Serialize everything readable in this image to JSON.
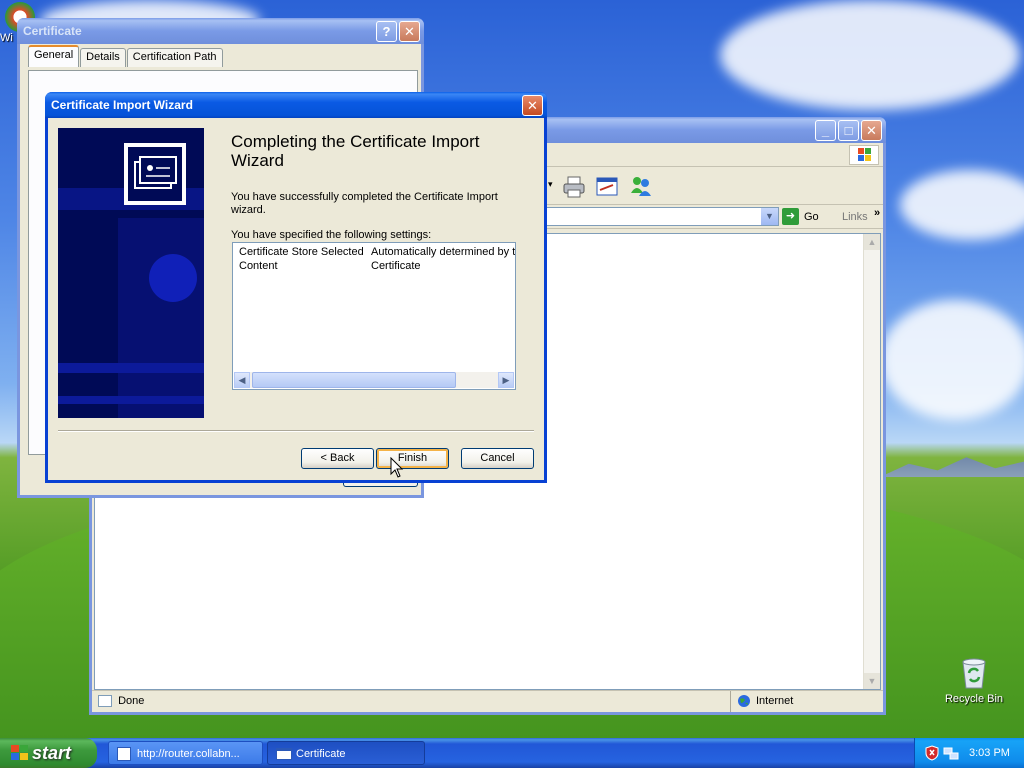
{
  "desktop": {
    "recycle_bin_label": "Recycle Bin",
    "partial_icon_label": "Wi"
  },
  "certificate_window": {
    "title": "Certificate",
    "help_glyph": "?",
    "close_glyph": "✕",
    "tabs": [
      {
        "label": "General"
      },
      {
        "label": "Details"
      },
      {
        "label": "Certification Path"
      }
    ]
  },
  "ie_window": {
    "min_glyph": "_",
    "max_glyph": "□",
    "close_glyph": "✕",
    "address_go_label": "Go",
    "links_label": "Links",
    "links_chevron": "»",
    "status_text": "Done",
    "zone_text": "Internet"
  },
  "wizard": {
    "title": "Certificate Import Wizard",
    "close_glyph": "✕",
    "heading": "Completing the Certificate Import Wizard",
    "success_text": "You have successfully completed the Certificate Import wizard.",
    "specified_text": "You have specified the following settings:",
    "settings": [
      {
        "key": "Certificate Store Selected",
        "value": "Automatically determined by t"
      },
      {
        "key": "Content",
        "value": "Certificate"
      }
    ],
    "buttons": {
      "back": "< Back",
      "finish": "Finish",
      "cancel": "Cancel"
    }
  },
  "taskbar": {
    "start_label": "start",
    "items": [
      {
        "label": "http://router.collabn..."
      },
      {
        "label": "Certificate"
      }
    ],
    "clock": "3:03 PM"
  }
}
